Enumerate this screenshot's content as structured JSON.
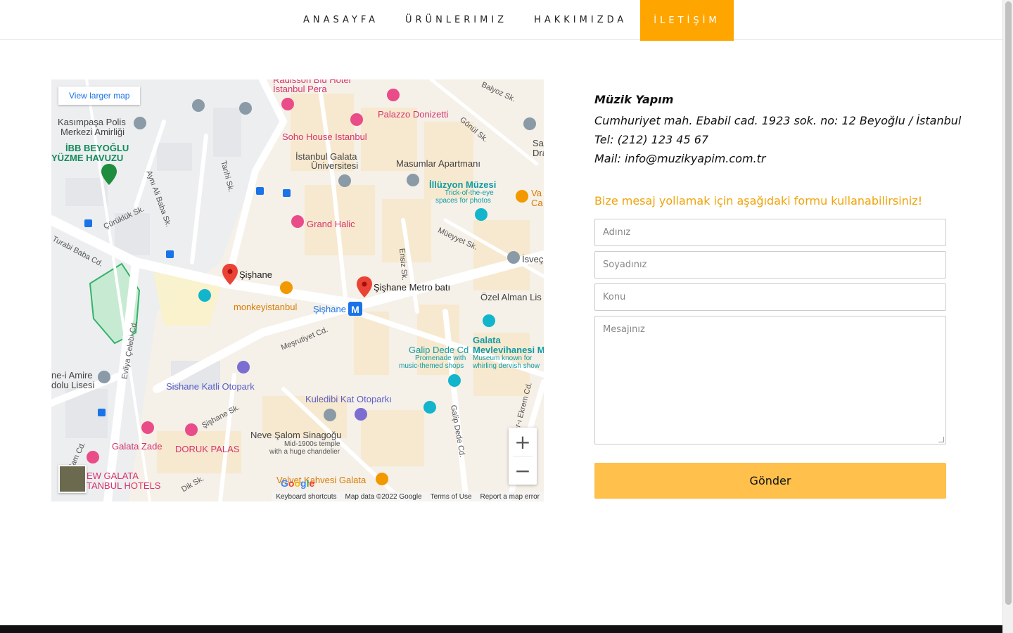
{
  "nav": {
    "items": [
      {
        "label": "ANASAYFA"
      },
      {
        "label": "ÜRÜNLERIMIZ"
      },
      {
        "label": "HAKKIMIZDA"
      },
      {
        "label": "İLETİŞİM",
        "active": true
      }
    ],
    "accent_color": "#ffa500"
  },
  "map": {
    "view_larger": "View larger map",
    "zoom_in": "+",
    "zoom_out": "−",
    "attribution": {
      "shortcuts": "Keyboard shortcuts",
      "data": "Map data ©2022 Google",
      "terms": "Terms of Use",
      "report": "Report a map error"
    },
    "logo": "Google",
    "places": {
      "radisson": "Radisson Blu Hotel",
      "istanbul_pera": "İstanbul Pera",
      "palazzo": "Palazzo Donizetti",
      "soho": "Soho House Istanbul",
      "galata_uni_1": "İstanbul Galata",
      "galata_uni_2": "Üniversitesi",
      "masumlar": "Masumlar Apartmanı",
      "illuzyon": "İllüzyon Müzesi",
      "illuzyon_sub1": "Trick-of-the-eye",
      "illuzyon_sub2": "spaces for photos",
      "kasimpasa1": "Kasımpaşa Polis",
      "kasimpasa2": "Merkezi Amirliği",
      "ibb1": "İBB BEYOĞLU",
      "ibb2": "YÜZME HAVUZU",
      "grand_halic": "Grand Halic",
      "sishane": "Şişhane",
      "sishane_metro": "Şişhane Metro batı",
      "sishane_m": "Şişhane",
      "monkey": "monkeyistanbul",
      "ozel_alman": "Özel Alman Lis",
      "isvec": "İsveç",
      "santa1": "Santa M",
      "santa2": "Draperi",
      "galata_dede": "Galip Dede Cd",
      "galata_dede_sub1": "Promenade with",
      "galata_dede_sub2": "music-themed shops",
      "mevlevi1": "Galata",
      "mevlevi2": "Mevlevihanesi M",
      "mevlevi_sub1": "Museum known for",
      "mevlevi_sub2": "whirling dervish show",
      "amire1": "ne-i Amire",
      "amire2": "dolu Lisesi",
      "katli": "Sishane Katli Otopark",
      "kuledibi": "Kuledibi Kat Otoparkı",
      "neve": "Neve Şalom Sinagoğu",
      "neve_sub1": "Mid-1900s temple",
      "neve_sub2": "with a huge chandelier",
      "galata_zade": "Galata Zade",
      "doruk": "DORUK PALAS",
      "new_galata1": "EW GALATA",
      "new_galata2": "TANBUL HOTELS",
      "kahvesi": "Velvet Kahvesi Galata",
      "va": "Va",
      "ca": "Ca"
    },
    "streets": {
      "turabi": "Turabi Baba Cd.",
      "aynali": "Aynı Ali Baba Sk.",
      "tarihi": "Tarihi Sk.",
      "curukluk": "Çürüklük Sk.",
      "evliya": "Evliya Çelebi Cd.",
      "mesrutiyet": "Meşrutiyet Cd.",
      "ensiz": "Ensiz Sk.",
      "mueyyet": "Müeyyet Sk.",
      "gonul": "Gönül Sk.",
      "balyoz": "Balyoz Sk.",
      "sishane_sk": "Şişhane Sk.",
      "galip_dede_cd": "Galip Dede Cd.",
      "ekrem": "dar-ı Ekrem Cd.",
      "saydam": "Saydam Cd.",
      "dik": "Dik Sk."
    }
  },
  "contact": {
    "company": "Müzik Yapım",
    "address": "Cumhuriyet mah. Ebabil cad. 1923 sok. no: 12 Beyoğlu / İstanbul",
    "phone": "Tel: (212) 123 45 67",
    "mail": "Mail: info@muzikyapim.com.tr",
    "intro": "Bize mesaj yollamak için aşağıdaki formu kullanabilirsiniz!",
    "intro_color": "#f0a30a"
  },
  "form": {
    "first_name_placeholder": "Adınız",
    "last_name_placeholder": "Soyadınız",
    "subject_placeholder": "Konu",
    "message_placeholder": "Mesajınız",
    "submit_label": "Gönder",
    "submit_color": "#ffc04c"
  }
}
